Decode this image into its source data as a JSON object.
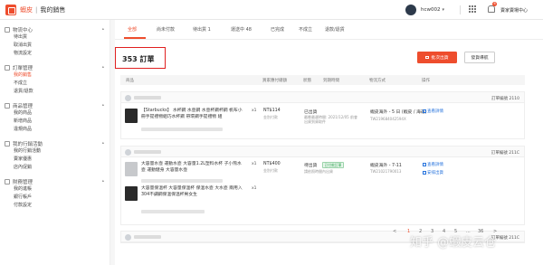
{
  "header": {
    "brand": "蝦皮",
    "separator": "|",
    "breadcrumb": "我的銷售",
    "username": "hcw002",
    "notification_count": "6",
    "seller_center": "賣家賣場中心"
  },
  "sidebar": {
    "groups": [
      {
        "title": "物流中心",
        "items": [
          "待出貨",
          "取消出貨",
          "物流設定"
        ]
      },
      {
        "title": "訂單管理",
        "items": [
          "我的銷售",
          "不成立",
          "退貨/退款"
        ]
      },
      {
        "title": "商品管理",
        "items": [
          "我的商品",
          "新增商品",
          "違規商品"
        ]
      },
      {
        "title": "我的行銷活動",
        "items": [
          "我的行銷活動",
          "賣家優惠",
          "店內促銷"
        ]
      },
      {
        "title": "財務管理",
        "items": [
          "我的進帳",
          "銀行帳戶",
          "付款設定"
        ]
      }
    ],
    "active_item": "我的銷售"
  },
  "tabs": [
    "全部",
    "尚未付款",
    "待出貨 1",
    "運送中 48",
    "已完成",
    "不成立",
    "退款/退貨"
  ],
  "summary": {
    "order_count": "353 訂單",
    "batch_ship_label": "批次出貨",
    "shipping_guide_label": "發貨導航"
  },
  "table_header": [
    "商品",
    "買家應付總額",
    "狀態",
    "到期時間",
    "物流方式",
    "操作"
  ],
  "orders": [
    {
      "order_no": "訂單編號 2110",
      "product_name": "【Starbucks】 水杯鋼 水壺鋼 水壺杯鋼杯鋼 帆布小冊手提禮物組巧水杯鋼 帶環鋼手提禮物 組",
      "qty": "x1",
      "total": "NT$114",
      "payment": "金別付款",
      "status": "已出貨",
      "status_sub": "最晚最遲時間: 2021/12/05 前會出貨到貨取件",
      "logistics": "蝦皮海外 - 5 日 (蝦皮 / 海運)",
      "tracking": "TW219684042594X",
      "action": "查看詳情"
    },
    {
      "order_no": "訂單編號 211C",
      "product_name_1": "大容量水壺 運動水壺 大容量1.2L塑料水杯 子小熊水壺 運動健身 大容量水壺",
      "qty_1": "x1",
      "product_name_2": "大容量保溫杯 大容量保溫杯 保溫水壺 大水壺 兩用入304不鏽鋼保溫保溫杯男女生",
      "qty_2": "x1",
      "total": "NT$400",
      "payment": "金別付款",
      "status": "待出貨",
      "status_badge": "已付款訂單",
      "status_sub": "請依照時間內出貨",
      "logistics": "蝦皮海外 - 7-11",
      "tracking": "TW21021790013",
      "action": "查看詳情",
      "action_2": "安排出貨"
    }
  ],
  "third_order_no": "訂單編號 211C",
  "pagination": [
    "<",
    "1",
    "2",
    "3",
    "4",
    "5",
    "...",
    "36",
    ">"
  ],
  "pagination_active": "1",
  "watermark": "知乎 @蝦皮云仓",
  "colors": {
    "accent": "#ee4d2d",
    "link": "#2673dd",
    "highlight_box": "#e02020"
  }
}
